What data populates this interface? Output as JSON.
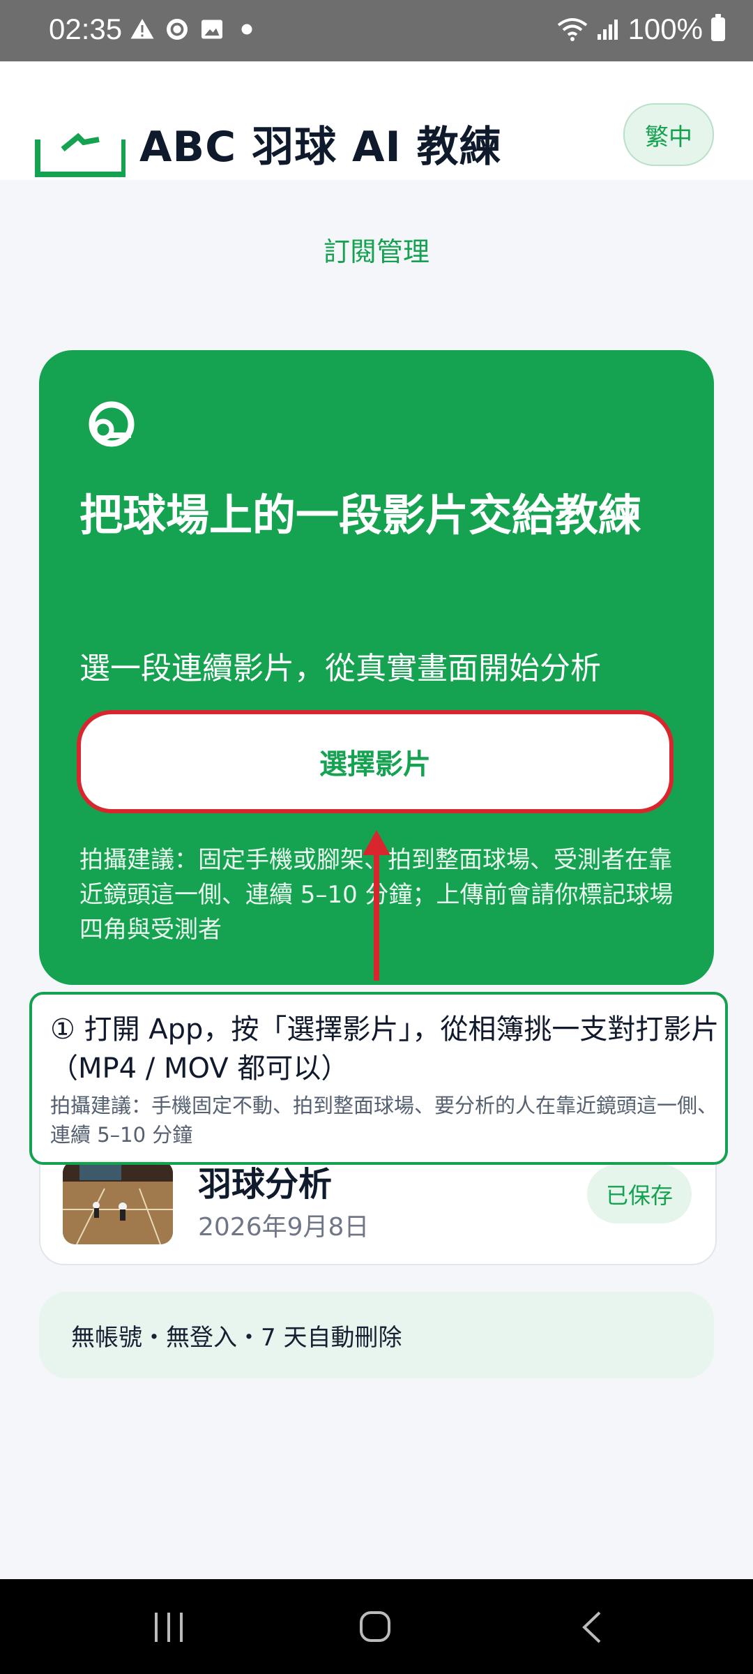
{
  "status_bar": {
    "time": "02:35",
    "left_icons": [
      "warning-icon",
      "sync-icon",
      "image-icon",
      "dot-icon"
    ],
    "battery": "100%"
  },
  "header": {
    "title": "ABC 羽球 AI 教練",
    "language_button": "繁中",
    "subscription_link": "訂閱管理"
  },
  "hero": {
    "title": "把球場上的一段影片交給教練",
    "subtitle": "選一段連續影片，從真實畫面開始分析",
    "button_label": "選擇影片",
    "tip": "拍攝建議：固定手機或腳架、拍到整面球場、受測者在靠近鏡頭這一側、連續 5–10 分鐘；上傳前會請你標記球場四角與受測者"
  },
  "overlay": {
    "main": "① 打開 App，按「選擇影片」，從相簿挑一支對打影片（MP4 / MOV 都可以）",
    "note": "拍攝建議：手機固定不動、拍到整面球場、要分析的人在靠近鏡頭這一側、連續 5–10 分鐘"
  },
  "recent": {
    "title": "羽球分析",
    "date": "2026年9月8日",
    "badge": "已保存"
  },
  "info": {
    "text": "無帳號・無登入・7 天自動刪除"
  },
  "colors": {
    "brand_green": "#15a352",
    "annotation_red": "#d9262e"
  }
}
